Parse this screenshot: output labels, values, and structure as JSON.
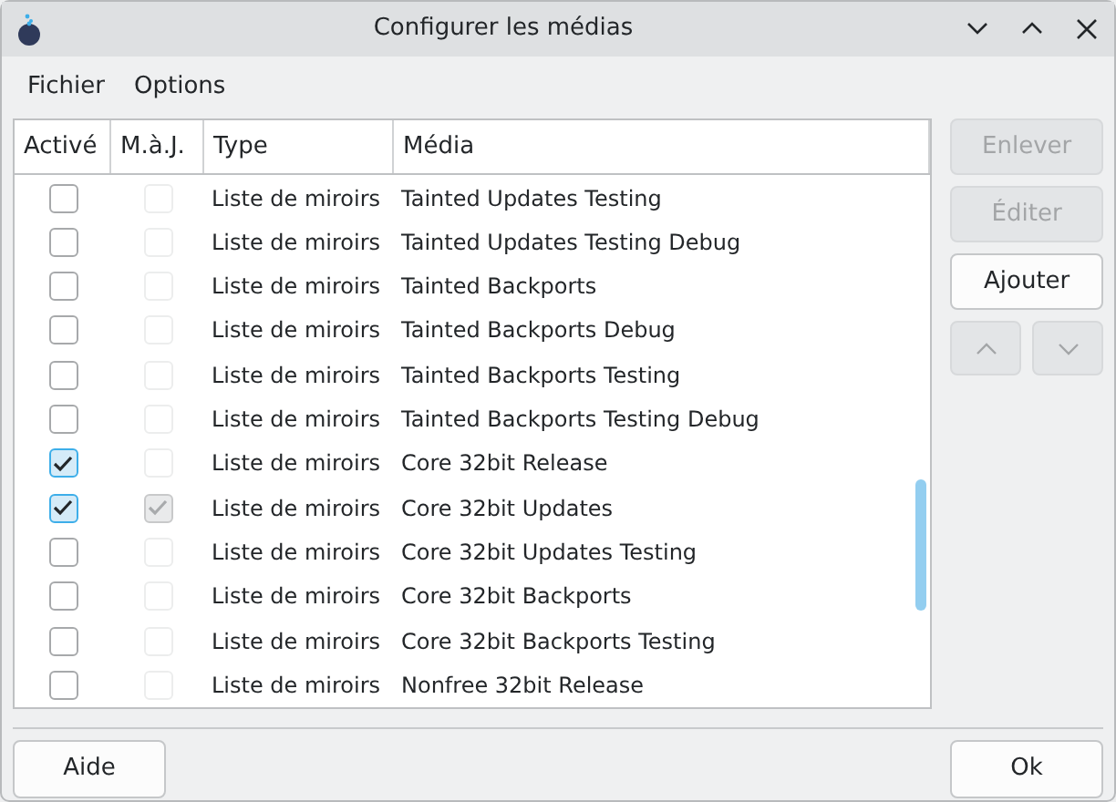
{
  "window": {
    "title": "Configurer les médias"
  },
  "menu": [
    "Fichier",
    "Options"
  ],
  "table": {
    "columns": [
      "Activé",
      "M.à.J.",
      "Type",
      "Média"
    ],
    "rows": [
      {
        "enabled": false,
        "update": false,
        "type": "Liste de miroirs",
        "media": "Tainted Updates Testing"
      },
      {
        "enabled": false,
        "update": false,
        "type": "Liste de miroirs",
        "media": "Tainted Updates Testing Debug"
      },
      {
        "enabled": false,
        "update": false,
        "type": "Liste de miroirs",
        "media": "Tainted Backports"
      },
      {
        "enabled": false,
        "update": false,
        "type": "Liste de miroirs",
        "media": "Tainted Backports Debug"
      },
      {
        "enabled": false,
        "update": false,
        "type": "Liste de miroirs",
        "media": "Tainted Backports Testing"
      },
      {
        "enabled": false,
        "update": false,
        "type": "Liste de miroirs",
        "media": "Tainted Backports Testing Debug"
      },
      {
        "enabled": true,
        "update": false,
        "type": "Liste de miroirs",
        "media": "Core 32bit Release"
      },
      {
        "enabled": true,
        "update": true,
        "type": "Liste de miroirs",
        "media": "Core 32bit Updates"
      },
      {
        "enabled": false,
        "update": false,
        "type": "Liste de miroirs",
        "media": "Core 32bit Updates Testing"
      },
      {
        "enabled": false,
        "update": false,
        "type": "Liste de miroirs",
        "media": "Core 32bit Backports"
      },
      {
        "enabled": false,
        "update": false,
        "type": "Liste de miroirs",
        "media": "Core 32bit Backports Testing"
      },
      {
        "enabled": false,
        "update": false,
        "type": "Liste de miroirs",
        "media": "Nonfree 32bit Release"
      }
    ]
  },
  "side_buttons": [
    {
      "label": "Enlever",
      "disabled": true
    },
    {
      "label": "Éditer",
      "disabled": true
    },
    {
      "label": "Ajouter",
      "disabled": false
    }
  ],
  "footer": {
    "left": "Aide",
    "right": "Ok"
  }
}
